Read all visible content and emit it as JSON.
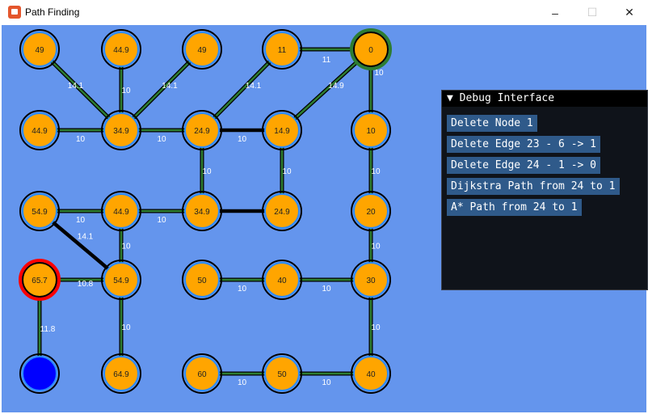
{
  "window": {
    "title": "Path Finding",
    "minimize": "–",
    "maximize": "☐",
    "close": "✕"
  },
  "graph": {
    "colors": {
      "background": "#6495ed",
      "node_fill": "#ffa500",
      "edge_path": "#2e7d32",
      "edge_plain": "#000000",
      "start_node": "#ff0000",
      "goal_node": "#2e7d32",
      "blue_node": "#0000ff"
    },
    "nodes": [
      {
        "id": "r0c0",
        "label": "49",
        "type": "normal"
      },
      {
        "id": "r0c1",
        "label": "44.9",
        "type": "normal"
      },
      {
        "id": "r0c2",
        "label": "49",
        "type": "normal"
      },
      {
        "id": "r0c3",
        "label": "11",
        "type": "normal"
      },
      {
        "id": "r0c4",
        "label": "0",
        "type": "goal"
      },
      {
        "id": "r1c0",
        "label": "44.9",
        "type": "normal"
      },
      {
        "id": "r1c1",
        "label": "34.9",
        "type": "normal"
      },
      {
        "id": "r1c2",
        "label": "24.9",
        "type": "normal"
      },
      {
        "id": "r1c3",
        "label": "14.9",
        "type": "normal"
      },
      {
        "id": "r1c4",
        "label": "10",
        "type": "normal"
      },
      {
        "id": "r2c0",
        "label": "54.9",
        "type": "normal"
      },
      {
        "id": "r2c1",
        "label": "44.9",
        "type": "normal"
      },
      {
        "id": "r2c2",
        "label": "34.9",
        "type": "normal"
      },
      {
        "id": "r2c3",
        "label": "24.9",
        "type": "normal"
      },
      {
        "id": "r2c4",
        "label": "20",
        "type": "normal"
      },
      {
        "id": "r3c0",
        "label": "65.7",
        "type": "start"
      },
      {
        "id": "r3c1",
        "label": "54.9",
        "type": "normal"
      },
      {
        "id": "r3c2",
        "label": "50",
        "type": "normal"
      },
      {
        "id": "r3c3",
        "label": "40",
        "type": "normal"
      },
      {
        "id": "r3c4",
        "label": "30",
        "type": "normal"
      },
      {
        "id": "r4c0",
        "label": "",
        "type": "blue"
      },
      {
        "id": "r4c1",
        "label": "64.9",
        "type": "normal"
      },
      {
        "id": "r4c2",
        "label": "60",
        "type": "normal"
      },
      {
        "id": "r4c3",
        "label": "50",
        "type": "normal"
      },
      {
        "id": "r4c4",
        "label": "40",
        "type": "normal"
      }
    ],
    "edges": [
      {
        "from": "r0c0",
        "to": "r1c1",
        "label": "14.1",
        "style": "path"
      },
      {
        "from": "r0c1",
        "to": "r1c1",
        "label": "10",
        "style": "path"
      },
      {
        "from": "r0c2",
        "to": "r1c1",
        "label": "14.1",
        "style": "path"
      },
      {
        "from": "r0c3",
        "to": "r0c4",
        "label": "11",
        "style": "path"
      },
      {
        "from": "r0c3",
        "to": "r1c2",
        "label": "14.1",
        "style": "path"
      },
      {
        "from": "r0c4",
        "to": "r1c3",
        "label": "14.9",
        "style": "path"
      },
      {
        "from": "r0c4",
        "to": "r1c4",
        "label": "10",
        "style": "path"
      },
      {
        "from": "r1c0",
        "to": "r1c1",
        "label": "10",
        "style": "path"
      },
      {
        "from": "r1c1",
        "to": "r1c2",
        "label": "10",
        "style": "path"
      },
      {
        "from": "r1c2",
        "to": "r1c3",
        "label": "10",
        "style": "plain"
      },
      {
        "from": "r1c2",
        "to": "r2c2",
        "label": "10",
        "style": "path"
      },
      {
        "from": "r1c3",
        "to": "r2c3",
        "label": "10",
        "style": "path"
      },
      {
        "from": "r1c4",
        "to": "r2c4",
        "label": "10",
        "style": "path"
      },
      {
        "from": "r2c0",
        "to": "r2c1",
        "label": "10",
        "style": "path"
      },
      {
        "from": "r2c1",
        "to": "r2c2",
        "label": "10",
        "style": "path"
      },
      {
        "from": "r2c2",
        "to": "r2c3",
        "label": "",
        "style": "plain"
      },
      {
        "from": "r2c0",
        "to": "r3c1",
        "label": "14.1",
        "style": "plain"
      },
      {
        "from": "r2c1",
        "to": "r3c1",
        "label": "10",
        "style": "path"
      },
      {
        "from": "r2c4",
        "to": "r3c4",
        "label": "10",
        "style": "path"
      },
      {
        "from": "r3c0",
        "to": "r3c1",
        "label": "10.8",
        "style": "path"
      },
      {
        "from": "r3c0",
        "to": "r4c0",
        "label": "11.8",
        "style": "path"
      },
      {
        "from": "r3c1",
        "to": "r4c1",
        "label": "10",
        "style": "path"
      },
      {
        "from": "r3c2",
        "to": "r3c3",
        "label": "10",
        "style": "path"
      },
      {
        "from": "r3c3",
        "to": "r3c4",
        "label": "10",
        "style": "path"
      },
      {
        "from": "r3c4",
        "to": "r4c4",
        "label": "10",
        "style": "path"
      },
      {
        "from": "r4c2",
        "to": "r4c3",
        "label": "10",
        "style": "path"
      },
      {
        "from": "r4c3",
        "to": "r4c4",
        "label": "10",
        "style": "path"
      }
    ]
  },
  "debug": {
    "header": "▼ Debug Interface",
    "buttons": [
      "Delete Node 1",
      "Delete Edge 23 - 6 -> 1",
      "Delete Edge 24 - 1 -> 0",
      "Dijkstra Path from 24 to 1",
      "A* Path from 24 to 1"
    ]
  }
}
